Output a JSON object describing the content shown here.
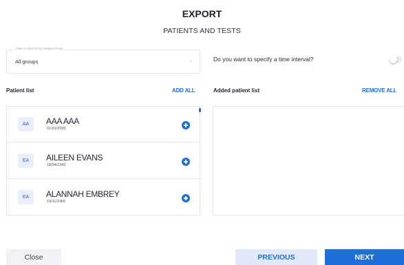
{
  "header": {
    "title": "EXPORT",
    "subtitle": "PATIENTS AND TESTS"
  },
  "filter": {
    "legend": "Filter Archive list by Subject Group",
    "value": "All groups"
  },
  "interval": {
    "label": "Do you want to specify a time interval?",
    "enabled": false
  },
  "patient_list": {
    "heading": "Patient list",
    "add_all_label": "ADD ALL",
    "items": [
      {
        "initials": "AA",
        "name": "AAA AAA",
        "dob": "01/01/2000"
      },
      {
        "initials": "EA",
        "name": "AILEEN EVANS",
        "dob": "18/04/1942"
      },
      {
        "initials": "EA",
        "name": "ALANNAH EMBREY",
        "dob": "19/11/1966"
      }
    ]
  },
  "added_list": {
    "heading": "Added patient list",
    "remove_all_label": "REMOVE ALL"
  },
  "footer": {
    "close_label": "Close",
    "previous_label": "PREVIOUS",
    "next_label": "NEXT"
  },
  "colors": {
    "accent": "#1e6fd9",
    "avatar_bg": "#e9eefa",
    "previous_bg": "#e1e9f8",
    "close_bg": "#f0f2f6"
  },
  "icons": {
    "add": "plus-circle-icon",
    "chevron": "chevron-down-icon"
  }
}
